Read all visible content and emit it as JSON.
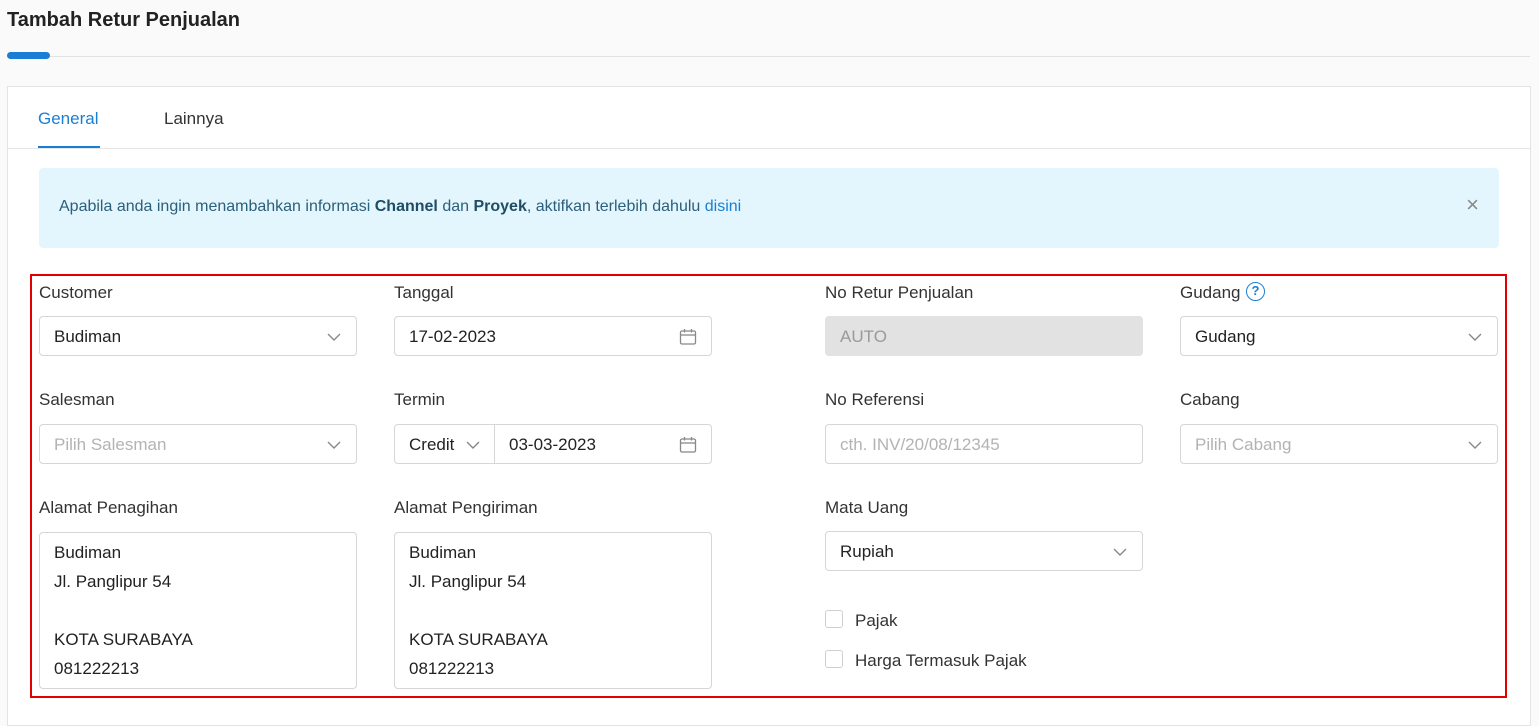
{
  "page": {
    "title": "Tambah Retur Penjualan"
  },
  "tabs": [
    {
      "label": "General",
      "active": true
    },
    {
      "label": "Lainnya",
      "active": false
    }
  ],
  "alert": {
    "prefix": "Apabila anda ingin menambahkan informasi ",
    "bold1": "Channel",
    "mid": " dan ",
    "bold2": "Proyek",
    "suffix": ", aktifkan terlebih dahulu ",
    "link": "disini",
    "close": "×"
  },
  "form": {
    "customer": {
      "label": "Customer",
      "value": "Budiman"
    },
    "tanggal": {
      "label": "Tanggal",
      "value": "17-02-2023"
    },
    "no_retur": {
      "label": "No Retur Penjualan",
      "value": "AUTO"
    },
    "gudang": {
      "label": "Gudang",
      "value": "Gudang",
      "help": "?"
    },
    "salesman": {
      "label": "Salesman",
      "placeholder": "Pilih Salesman"
    },
    "termin": {
      "label": "Termin",
      "type": "Credit",
      "date": "03-03-2023"
    },
    "no_referensi": {
      "label": "No Referensi",
      "placeholder": "cth. INV/20/08/12345"
    },
    "cabang": {
      "label": "Cabang",
      "placeholder": "Pilih Cabang"
    },
    "alamat_penagihan": {
      "label": "Alamat Penagihan",
      "lines": [
        "Budiman",
        "Jl. Panglipur 54",
        "",
        "KOTA SURABAYA",
        "081222213"
      ]
    },
    "alamat_pengiriman": {
      "label": "Alamat Pengiriman",
      "lines": [
        "Budiman",
        "Jl. Panglipur 54",
        "",
        "KOTA SURABAYA",
        "081222213"
      ]
    },
    "mata_uang": {
      "label": "Mata Uang",
      "value": "Rupiah"
    },
    "pajak": {
      "label": "Pajak",
      "checked": false
    },
    "harga_termasuk_pajak": {
      "label": "Harga Termasuk Pajak",
      "checked": false
    }
  },
  "colors": {
    "accent": "#1a7fd4",
    "highlight": "#e00000",
    "alert_bg": "#e3f5fd"
  },
  "icons": {
    "dropdown": "chevron-down-icon",
    "date": "calendar-icon",
    "close": "close-icon",
    "help": "help-circle-icon"
  }
}
